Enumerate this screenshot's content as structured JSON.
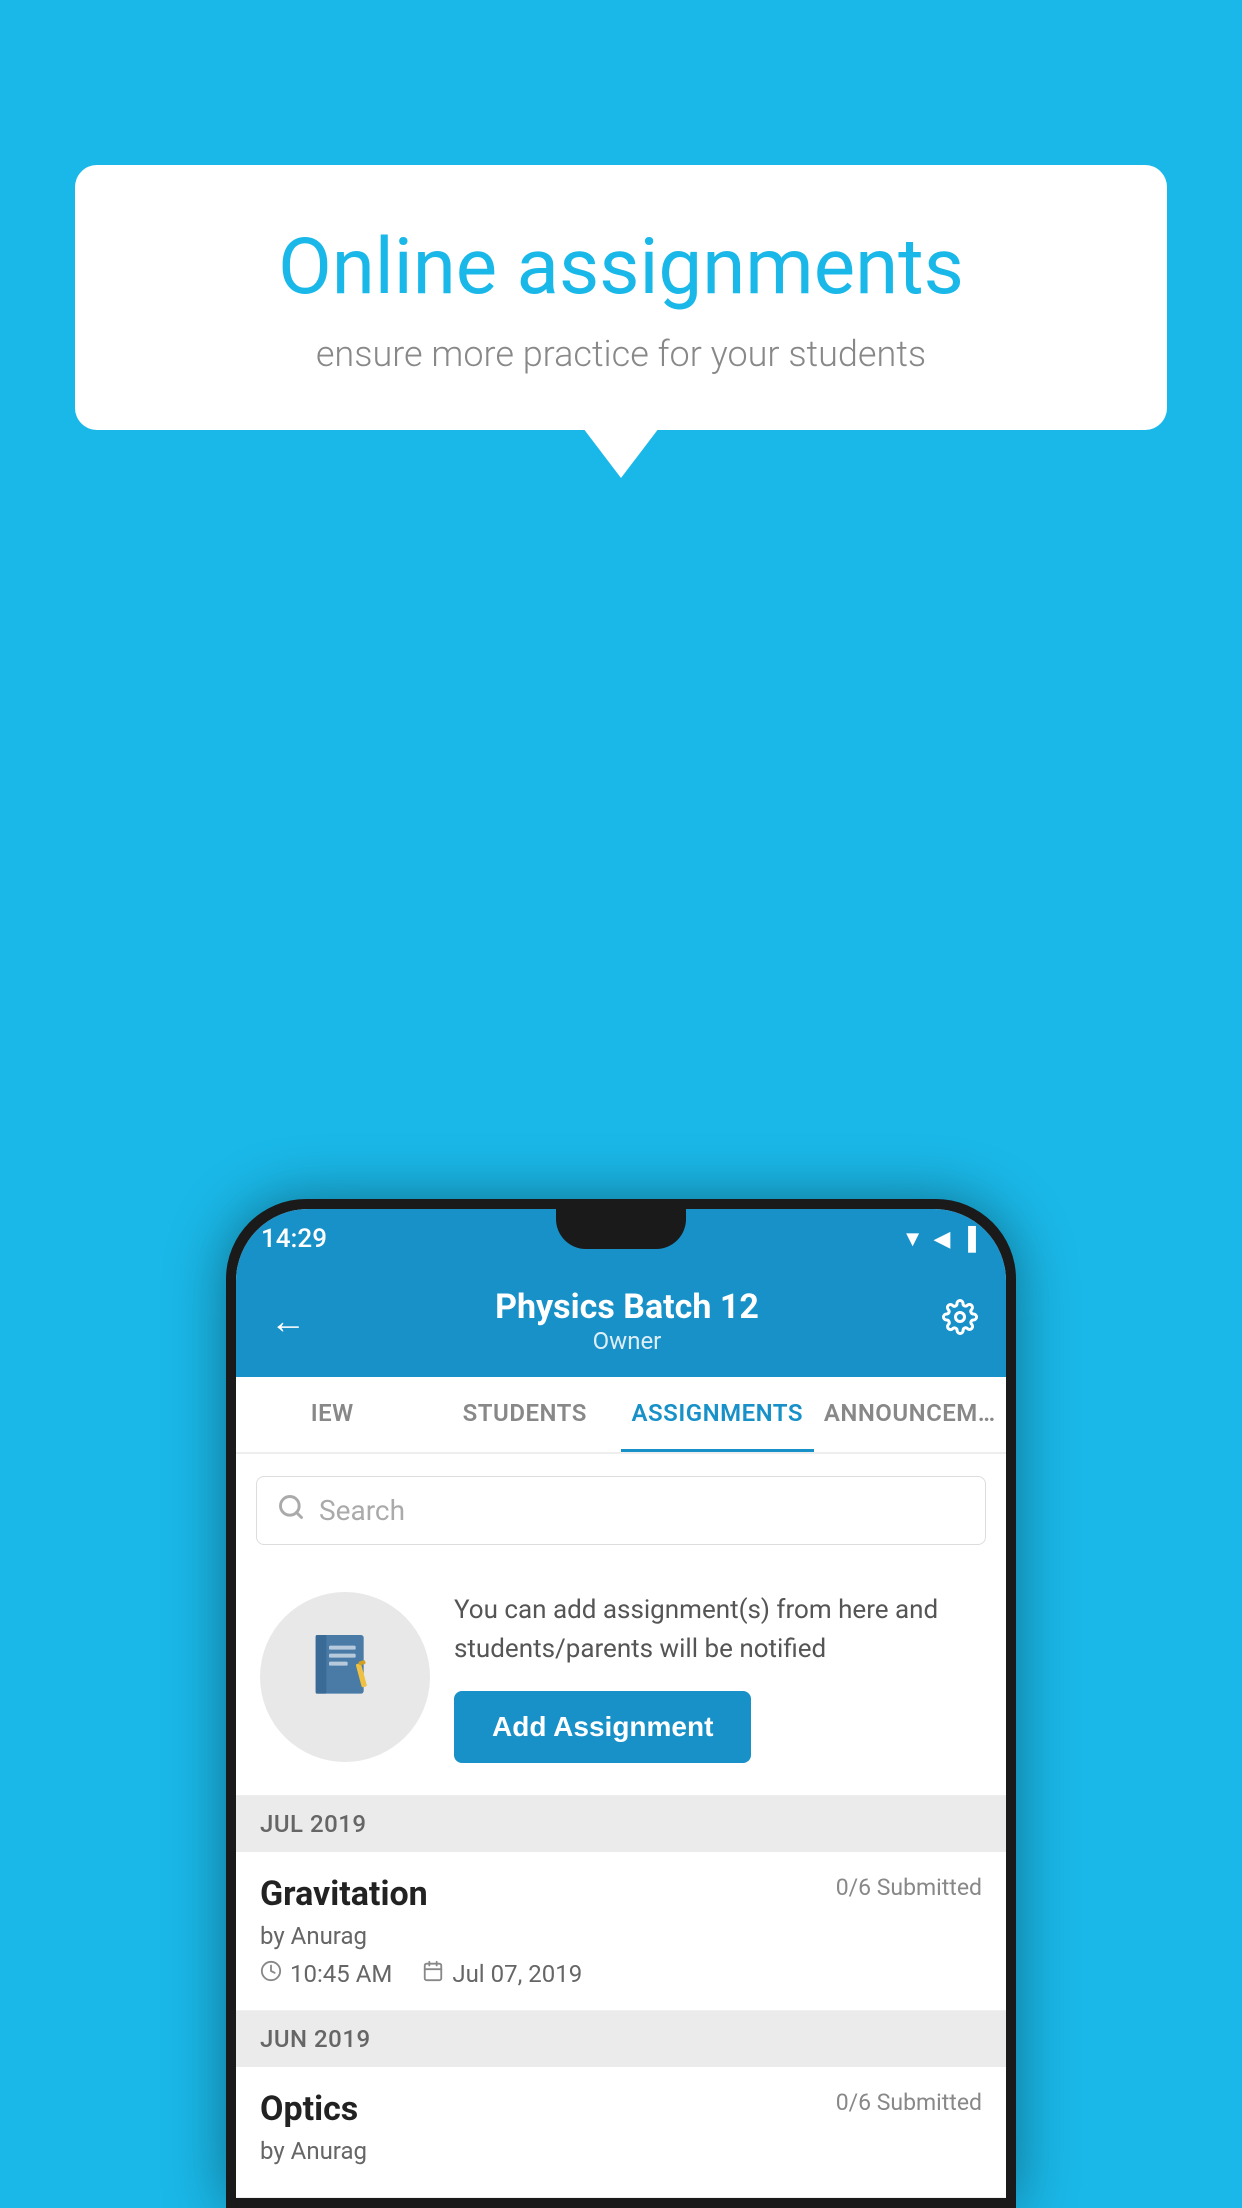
{
  "background_color": "#1ab8e8",
  "promo": {
    "title": "Online assignments",
    "subtitle": "ensure more practice for your students"
  },
  "phone": {
    "status_bar": {
      "time": "14:29",
      "icons": "▼◀▐"
    },
    "header": {
      "title": "Physics Batch 12",
      "subtitle": "Owner",
      "back_label": "←",
      "settings_label": "⚙"
    },
    "tabs": [
      {
        "label": "IEW",
        "active": false
      },
      {
        "label": "STUDENTS",
        "active": false
      },
      {
        "label": "ASSIGNMENTS",
        "active": true
      },
      {
        "label": "ANNOUNCEM…",
        "active": false
      }
    ],
    "search": {
      "placeholder": "Search"
    },
    "add_assignment_section": {
      "description": "You can add assignment(s) from here and students/parents will be notified",
      "button_label": "Add Assignment"
    },
    "sections": [
      {
        "label": "JUL 2019",
        "assignments": [
          {
            "name": "Gravitation",
            "submitted": "0/6 Submitted",
            "author": "by Anurag",
            "time": "10:45 AM",
            "date": "Jul 07, 2019"
          }
        ]
      },
      {
        "label": "JUN 2019",
        "assignments": [
          {
            "name": "Optics",
            "submitted": "0/6 Submitted",
            "author": "by Anurag",
            "time": "",
            "date": ""
          }
        ]
      }
    ]
  }
}
